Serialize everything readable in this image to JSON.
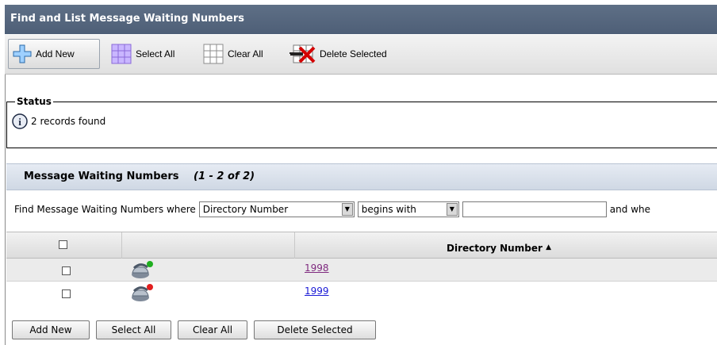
{
  "page": {
    "title": "Find and List Message Waiting Numbers"
  },
  "toolbar": {
    "add_new": "Add New",
    "select_all": "Select All",
    "clear_all": "Clear All",
    "delete_selected": "Delete Selected"
  },
  "status": {
    "legend": "Status",
    "message": "2 records found",
    "icon": "info-icon"
  },
  "panel": {
    "title": "Message Waiting Numbers",
    "range": "(1 - 2 of 2)"
  },
  "find": {
    "prefix": "Find Message Waiting Numbers where",
    "field_selected": "Directory Number",
    "operator_selected": "begins with",
    "search_value": "",
    "suffix": "and whe"
  },
  "table": {
    "columns": [
      "",
      "",
      "Directory Number"
    ],
    "sort_indicator": "▲",
    "rows": [
      {
        "checked": false,
        "status_color": "#1fae1f",
        "directory_number": "1998"
      },
      {
        "checked": false,
        "status_color": "#e21f1f",
        "directory_number": "1999"
      }
    ]
  },
  "bottom_buttons": {
    "add_new": "Add New",
    "select_all": "Select All",
    "clear_all": "Clear All",
    "delete_selected": "Delete Selected"
  }
}
